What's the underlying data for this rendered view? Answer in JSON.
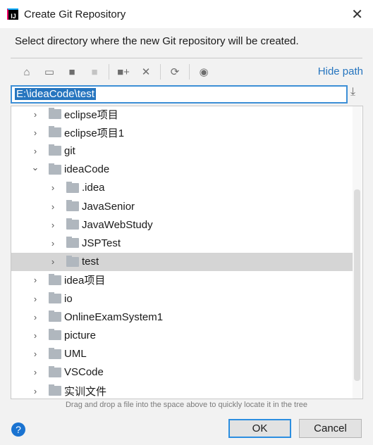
{
  "window": {
    "title": "Create Git Repository",
    "close": "✕"
  },
  "instruction": "Select directory where the new Git repository will be created.",
  "toolbar": {
    "hide_path": "Hide path",
    "icons": [
      "home-icon",
      "desktop-icon",
      "project-folder-icon",
      "module-folder-icon",
      "new-folder-icon",
      "delete-icon",
      "refresh-icon",
      "show-hidden-icon"
    ]
  },
  "path": {
    "value": "E:\\ideaCode\\test"
  },
  "tree": [
    {
      "label": "eclipse项目",
      "level": 0,
      "expanded": false
    },
    {
      "label": "eclipse项目1",
      "level": 0,
      "expanded": false
    },
    {
      "label": "git",
      "level": 0,
      "expanded": false
    },
    {
      "label": "ideaCode",
      "level": 0,
      "expanded": true
    },
    {
      "label": ".idea",
      "level": 1,
      "expanded": false
    },
    {
      "label": "JavaSenior",
      "level": 1,
      "expanded": false
    },
    {
      "label": "JavaWebStudy",
      "level": 1,
      "expanded": false
    },
    {
      "label": "JSPTest",
      "level": 1,
      "expanded": false
    },
    {
      "label": "test",
      "level": 1,
      "expanded": false,
      "selected": true
    },
    {
      "label": "idea项目",
      "level": 0,
      "expanded": false
    },
    {
      "label": "io",
      "level": 0,
      "expanded": false
    },
    {
      "label": "OnlineExamSystem1",
      "level": 0,
      "expanded": false
    },
    {
      "label": "picture",
      "level": 0,
      "expanded": false
    },
    {
      "label": "UML",
      "level": 0,
      "expanded": false
    },
    {
      "label": "VSCode",
      "level": 0,
      "expanded": false
    },
    {
      "label": "实训文件",
      "level": 0,
      "expanded": false
    }
  ],
  "hint": "Drag and drop a file into the space above to quickly locate it in the tree",
  "buttons": {
    "ok": "OK",
    "cancel": "Cancel",
    "help": "?"
  }
}
